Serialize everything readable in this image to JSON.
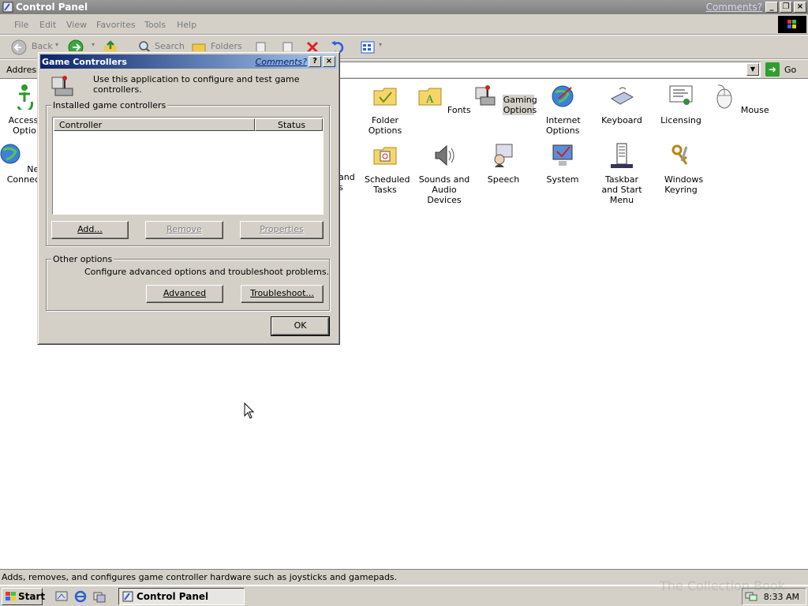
{
  "window": {
    "title": "Control Panel",
    "comments_link": "Comments?",
    "menu": [
      "File",
      "Edit",
      "View",
      "Favorites",
      "Tools",
      "Help"
    ],
    "toolbar": {
      "back": "Back",
      "search": "Search",
      "folders": "Folders"
    },
    "address_label": "Address",
    "go_label": "Go",
    "status_text": "Adds, removes, and configures game controller hardware such as joysticks and gamepads."
  },
  "icons": [
    {
      "label": "Accessibility Options",
      "shown": "Accessi​Optio",
      "icon": "accessibility-icon"
    },
    {
      "label": "Folder Options",
      "icon": "folder-options-icon"
    },
    {
      "label": "Fonts",
      "icon": "fonts-icon"
    },
    {
      "label": "Gaming Options",
      "icon": "gaming-options-icon",
      "selected": true
    },
    {
      "label": "Internet Options",
      "icon": "internet-options-icon"
    },
    {
      "label": "Keyboard",
      "icon": "keyboard-icon"
    },
    {
      "label": "Licensing",
      "icon": "licensing-icon"
    },
    {
      "label": "Mouse",
      "icon": "mouse-icon"
    },
    {
      "label": "Network Connections",
      "icon": "network-icon"
    },
    {
      "label": "Scheduled Tasks",
      "icon": "scheduled-tasks-icon"
    },
    {
      "label": "Sounds and Audio Devices",
      "icon": "sounds-icon"
    },
    {
      "label": "Speech",
      "icon": "speech-icon"
    },
    {
      "label": "System",
      "icon": "system-icon"
    },
    {
      "label": "Taskbar and Start Menu",
      "icon": "taskbar-icon"
    },
    {
      "label": "Windows Keyring",
      "icon": "keyring-icon"
    }
  ],
  "partial_labels": {
    "acc1": "Accessi",
    "acc2": "Optio",
    "net1": "Netwo",
    "net2": "Connecti",
    "hidden1": "and",
    "hidden2": "s"
  },
  "dialog": {
    "title": "Game Controllers",
    "comments_link": "Comments?",
    "help": "?",
    "close": "×",
    "intro": "Use this application to configure and test game controllers.",
    "installed_group": "Installed game controllers",
    "columns": [
      "Controller",
      "Status"
    ],
    "rows": [],
    "add": "Add...",
    "remove": "Remove",
    "properties": "Properties",
    "other_group": "Other options",
    "other_text": "Configure advanced options and troubleshoot problems.",
    "advanced": "Advanced",
    "troubleshoot": "Troubleshoot...",
    "ok": "OK"
  },
  "taskbar": {
    "start": "Start",
    "task": "Control Panel",
    "clock": "8:33 AM",
    "watermark": "The Collection Book"
  }
}
